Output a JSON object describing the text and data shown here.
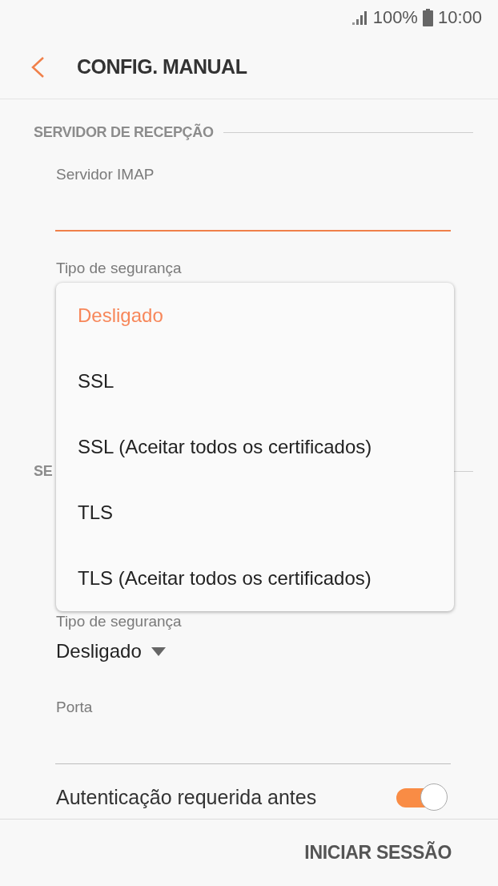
{
  "status_bar": {
    "battery": "100%",
    "time": "10:00"
  },
  "header": {
    "title": "CONFIG. MANUAL"
  },
  "incoming": {
    "section_title": "SERVIDOR DE RECEPÇÃO",
    "server_field": {
      "label": "Servidor IMAP",
      "focused": true
    },
    "security_label": "Tipo de segurança"
  },
  "outgoing": {
    "section_title": "SE",
    "security_label": "Tipo de segurança",
    "security_value": "Desligado",
    "port_field": {
      "label": "Porta",
      "focused": false
    },
    "auth": {
      "label": "Autenticação requerida antes",
      "on": true
    }
  },
  "dropdown": {
    "options": [
      {
        "label": "Desligado",
        "selected": true
      },
      {
        "label": "SSL",
        "selected": false
      },
      {
        "label": "SSL (Aceitar todos os certificados)",
        "selected": false
      },
      {
        "label": "TLS",
        "selected": false
      },
      {
        "label": "TLS (Aceitar todos os certificados)",
        "selected": false
      }
    ]
  },
  "bottom_bar": {
    "button": "INICIAR SESSÃO"
  }
}
